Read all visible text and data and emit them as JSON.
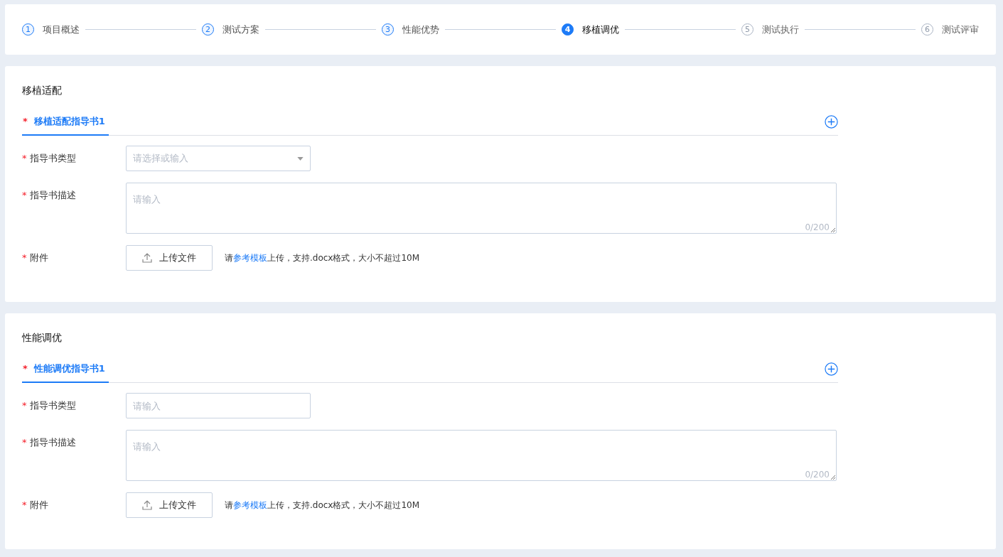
{
  "steps": [
    {
      "number": "1",
      "label": "项目概述",
      "kind": "done"
    },
    {
      "number": "2",
      "label": "测试方案",
      "kind": "done"
    },
    {
      "number": "3",
      "label": "性能优势",
      "kind": "done"
    },
    {
      "number": "4",
      "label": "移植调优",
      "kind": "current"
    },
    {
      "number": "5",
      "label": "测试执行",
      "kind": "pending"
    },
    {
      "number": "6",
      "label": "测试评审",
      "kind": "pending"
    }
  ],
  "sections": [
    {
      "title": "移植适配",
      "tabs": [
        {
          "mark": "*",
          "label": "移植适配指导书1",
          "selected": true
        }
      ],
      "fields": [
        {
          "kind": "select",
          "mark": "*",
          "label": "指导书类型",
          "placeholder": "请选择或输入"
        },
        {
          "kind": "textarea",
          "mark": "*",
          "label": "指导书描述",
          "placeholder": "请输入",
          "counter": "0/200"
        },
        {
          "kind": "upload",
          "mark": "*",
          "label": "附件",
          "button": "上传文件",
          "hint_before": "请",
          "hint_link": "参考模板",
          "hint_after": "上传，支持.docx格式，大小不超过10M"
        }
      ]
    },
    {
      "title": "性能调优",
      "tabs": [
        {
          "mark": "*",
          "label": "性能调优指导书1",
          "selected": true
        }
      ],
      "fields": [
        {
          "kind": "text",
          "mark": "*",
          "label": "指导书类型",
          "placeholder": "请输入"
        },
        {
          "kind": "textarea",
          "mark": "*",
          "label": "指导书描述",
          "placeholder": "请输入",
          "counter": "0/200"
        },
        {
          "kind": "upload",
          "mark": "*",
          "label": "附件",
          "button": "上传文件",
          "hint_before": "请",
          "hint_link": "参考模板",
          "hint_after": "上传，支持.docx格式，大小不超过10M"
        }
      ]
    }
  ]
}
